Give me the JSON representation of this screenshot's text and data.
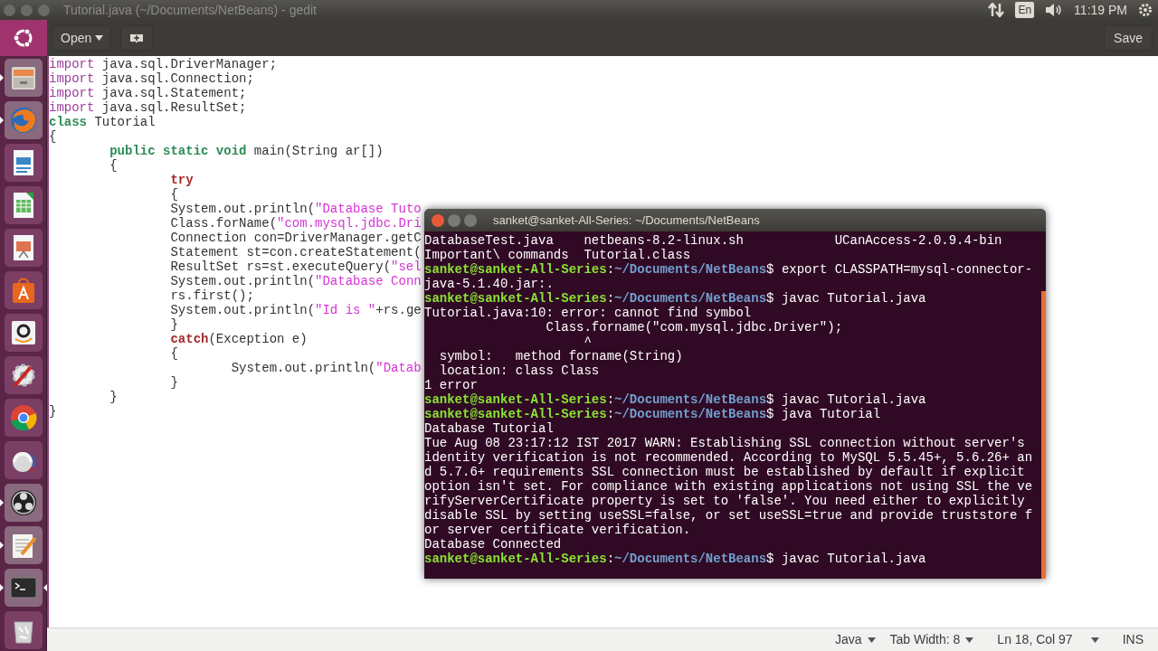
{
  "top_panel": {
    "window_title": "Tutorial.java (~/Documents/NetBeans) - gedit",
    "keyboard_layout": "En",
    "clock": "11:19 PM"
  },
  "launcher": [
    {
      "kind": "files",
      "running": true
    },
    {
      "kind": "firefox",
      "running": true
    },
    {
      "kind": "writer",
      "running": false
    },
    {
      "kind": "calc",
      "running": false
    },
    {
      "kind": "impress",
      "running": false
    },
    {
      "kind": "software",
      "running": false
    },
    {
      "kind": "amazon",
      "running": false
    },
    {
      "kind": "settings",
      "running": false
    },
    {
      "kind": "chrome",
      "running": false
    },
    {
      "kind": "sphere",
      "running": false
    },
    {
      "kind": "obs",
      "running": true
    },
    {
      "kind": "editor",
      "running": true
    },
    {
      "kind": "terminal",
      "running": true,
      "focused": true
    },
    {
      "kind": "trash",
      "running": false
    }
  ],
  "header": {
    "open_button": "Open",
    "save_button": "Save"
  },
  "code_lines": [
    [
      {
        "text": "import",
        "kind": "import"
      },
      {
        "text": " java.sql.DriverManager;",
        "kind": "plain"
      }
    ],
    [
      {
        "text": "import",
        "kind": "import"
      },
      {
        "text": " java.sql.Connection;",
        "kind": "plain"
      }
    ],
    [
      {
        "text": "import",
        "kind": "import"
      },
      {
        "text": " java.sql.Statement;",
        "kind": "plain"
      }
    ],
    [
      {
        "text": "import",
        "kind": "import"
      },
      {
        "text": " java.sql.ResultSet;",
        "kind": "plain"
      }
    ],
    [
      {
        "text": "class",
        "kind": "type"
      },
      {
        "text": " Tutorial",
        "kind": "plain"
      }
    ],
    [
      {
        "text": "{",
        "kind": "plain"
      }
    ],
    [
      {
        "text": "        public static void",
        "kind": "type"
      },
      {
        "text": " main(String ar[])",
        "kind": "plain"
      }
    ],
    [
      {
        "text": "        {",
        "kind": "plain"
      }
    ],
    [
      {
        "text": "                try",
        "kind": "control"
      }
    ],
    [
      {
        "text": "                {",
        "kind": "plain"
      }
    ],
    [
      {
        "text": "                System.out.println(",
        "kind": "plain"
      },
      {
        "text": "\"Database Tuto",
        "kind": "string"
      }
    ],
    [
      {
        "text": "                Class.forName(",
        "kind": "plain"
      },
      {
        "text": "\"com.mysql.jdbc.Dri",
        "kind": "string"
      }
    ],
    [
      {
        "text": "                Connection con=DriverManager.getC",
        "kind": "plain"
      }
    ],
    [
      {
        "text": "                Statement st=con.createStatement(",
        "kind": "plain"
      }
    ],
    [
      {
        "text": "                ResultSet rs=st.executeQuery(",
        "kind": "plain"
      },
      {
        "text": "\"sel",
        "kind": "string"
      }
    ],
    [
      {
        "text": "                System.out.println(",
        "kind": "plain"
      },
      {
        "text": "\"Database Conn",
        "kind": "string"
      }
    ],
    [
      {
        "text": "                rs.first();",
        "kind": "plain"
      }
    ],
    [
      {
        "text": "                System.out.println(",
        "kind": "plain"
      },
      {
        "text": "\"Id is \"",
        "kind": "string"
      },
      {
        "text": "+rs.ge",
        "kind": "plain"
      }
    ],
    [
      {
        "text": "                }",
        "kind": "plain"
      }
    ],
    [
      {
        "text": "                catch",
        "kind": "control"
      },
      {
        "text": "(Exception e)",
        "kind": "plain"
      }
    ],
    [
      {
        "text": "                {",
        "kind": "plain"
      }
    ],
    [
      {
        "text": "                        System.out.println(",
        "kind": "plain"
      },
      {
        "text": "\"Datab",
        "kind": "string"
      }
    ],
    [
      {
        "text": "                }",
        "kind": "plain"
      }
    ],
    [
      {
        "text": "        }",
        "kind": "plain"
      }
    ],
    [
      {
        "text": "}",
        "kind": "plain"
      }
    ]
  ],
  "terminal": {
    "title": "sanket@sanket-All-Series: ~/Documents/NetBeans",
    "lines": [
      {
        "kind": "output",
        "text": "DatabaseTest.java    netbeans-8.2-linux.sh            UCanAccess-2.0.9.4-bin"
      },
      {
        "kind": "output",
        "text": "Important\\ commands  Tutorial.class"
      },
      {
        "kind": "prompt",
        "user": "sanket@sanket-All-Series",
        "separator": ":",
        "path": "~/Documents/NetBeans",
        "command": "$ export CLASSPATH=mysql-connector-"
      },
      {
        "kind": "output",
        "text": "java-5.1.40.jar:."
      },
      {
        "kind": "prompt",
        "user": "sanket@sanket-All-Series",
        "separator": ":",
        "path": "~/Documents/NetBeans",
        "command": "$ javac Tutorial.java"
      },
      {
        "kind": "output",
        "text": "Tutorial.java:10: error: cannot find symbol"
      },
      {
        "kind": "output",
        "text": "                Class.forname(\"com.mysql.jdbc.Driver\");"
      },
      {
        "kind": "output",
        "text": "                     ^"
      },
      {
        "kind": "output",
        "text": "  symbol:   method forname(String)"
      },
      {
        "kind": "output",
        "text": "  location: class Class"
      },
      {
        "kind": "output",
        "text": "1 error"
      },
      {
        "kind": "prompt",
        "user": "sanket@sanket-All-Series",
        "separator": ":",
        "path": "~/Documents/NetBeans",
        "command": "$ javac Tutorial.java"
      },
      {
        "kind": "prompt",
        "user": "sanket@sanket-All-Series",
        "separator": ":",
        "path": "~/Documents/NetBeans",
        "command": "$ java Tutorial"
      },
      {
        "kind": "output",
        "text": "Database Tutorial"
      },
      {
        "kind": "output",
        "text": "Tue Aug 08 23:17:12 IST 2017 WARN: Establishing SSL connection without server's"
      },
      {
        "kind": "output",
        "text": "identity verification is not recommended. According to MySQL 5.5.45+, 5.6.26+ an"
      },
      {
        "kind": "output",
        "text": "d 5.7.6+ requirements SSL connection must be established by default if explicit"
      },
      {
        "kind": "output",
        "text": "option isn't set. For compliance with existing applications not using SSL the ve"
      },
      {
        "kind": "output",
        "text": "rifyServerCertificate property is set to 'false'. You need either to explicitly"
      },
      {
        "kind": "output",
        "text": "disable SSL by setting useSSL=false, or set useSSL=true and provide truststore f"
      },
      {
        "kind": "output",
        "text": "or server certificate verification."
      },
      {
        "kind": "output",
        "text": "Database Connected"
      },
      {
        "kind": "prompt",
        "user": "sanket@sanket-All-Series",
        "separator": ":",
        "path": "~/Documents/NetBeans",
        "command": "$ javac Tutorial.java"
      }
    ]
  },
  "status_bar": {
    "language": "Java",
    "tab_width": "Tab Width: 8",
    "position": "Ln 18, Col 97",
    "mode": "INS"
  }
}
